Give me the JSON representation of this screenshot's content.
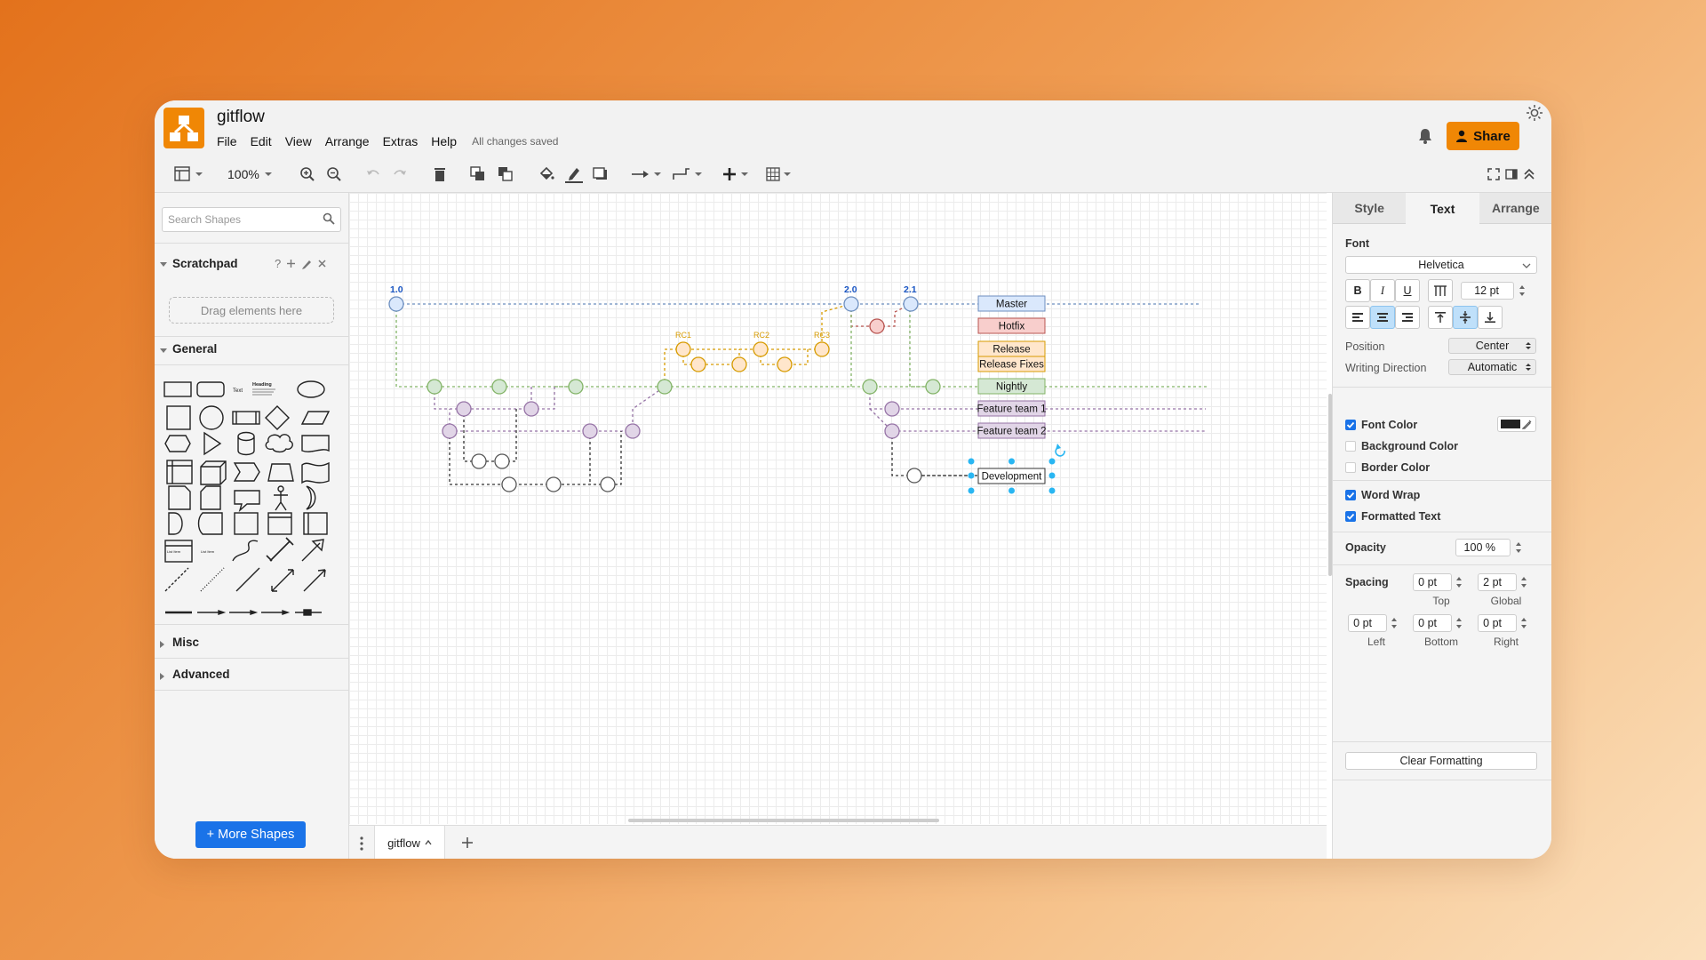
{
  "header": {
    "title": "gitflow",
    "menu": [
      "File",
      "Edit",
      "View",
      "Arrange",
      "Extras",
      "Help"
    ],
    "save_status": "All changes saved",
    "share_label": "Share"
  },
  "toolbar": {
    "zoom": "100%"
  },
  "sidebar": {
    "search_placeholder": "Search Shapes",
    "scratchpad_title": "Scratchpad",
    "scratchpad_help": "?",
    "drag_hint": "Drag elements here",
    "general_title": "General",
    "misc_title": "Misc",
    "advanced_title": "Advanced",
    "more_shapes_label": "+ More Shapes",
    "shape_text_label": "Text",
    "shape_heading_label": "Heading",
    "shape_list_label": "List Item"
  },
  "diagram": {
    "versions": [
      "1.0",
      "2.0",
      "2.1"
    ],
    "rc_labels": [
      "RC1",
      "RC2",
      "RC3"
    ],
    "legend": [
      "Master",
      "Hotfix",
      "Release",
      "Release Fixes",
      "Nightly",
      "Feature team 1",
      "Feature team 2",
      "Development"
    ],
    "colors": {
      "master": "#dae8fc",
      "master_stroke": "#6c8ebf",
      "hotfix": "#f8cecc",
      "hotfix_stroke": "#b85450",
      "release": "#ffe6cc",
      "release_stroke": "#d79b00",
      "nightly": "#d5e8d4",
      "nightly_stroke": "#82b366",
      "feature": "#e1d5e7",
      "feature_stroke": "#9673a6",
      "development": "#ffffff",
      "development_stroke": "#333333",
      "selection": "#29b6f2"
    }
  },
  "bottom": {
    "page_tab": "gitflow"
  },
  "panel": {
    "tabs": [
      "Style",
      "Text",
      "Arrange"
    ],
    "active_tab": "Text",
    "font_label": "Font",
    "font_family": "Helvetica",
    "font_size": "12 pt",
    "bold": "B",
    "italic": "I",
    "underline": "U",
    "position_label": "Position",
    "position_value": "Center",
    "writing_direction_label": "Writing Direction",
    "writing_direction_value": "Automatic",
    "font_color_label": "Font Color",
    "font_color": "#222222",
    "background_color_label": "Background Color",
    "border_color_label": "Border Color",
    "word_wrap_label": "Word Wrap",
    "formatted_text_label": "Formatted Text",
    "opacity_label": "Opacity",
    "opacity_value": "100 %",
    "spacing_label": "Spacing",
    "spacing": {
      "top": "0 pt",
      "global": "2 pt",
      "left": "0 pt",
      "bottom": "0 pt",
      "right": "0 pt",
      "top_label": "Top",
      "global_label": "Global",
      "left_label": "Left",
      "bottom_label": "Bottom",
      "right_label": "Right"
    },
    "clear_formatting_label": "Clear Formatting"
  },
  "colors": {
    "accent": "#f08705",
    "primary_blue": "#1a73e8"
  }
}
